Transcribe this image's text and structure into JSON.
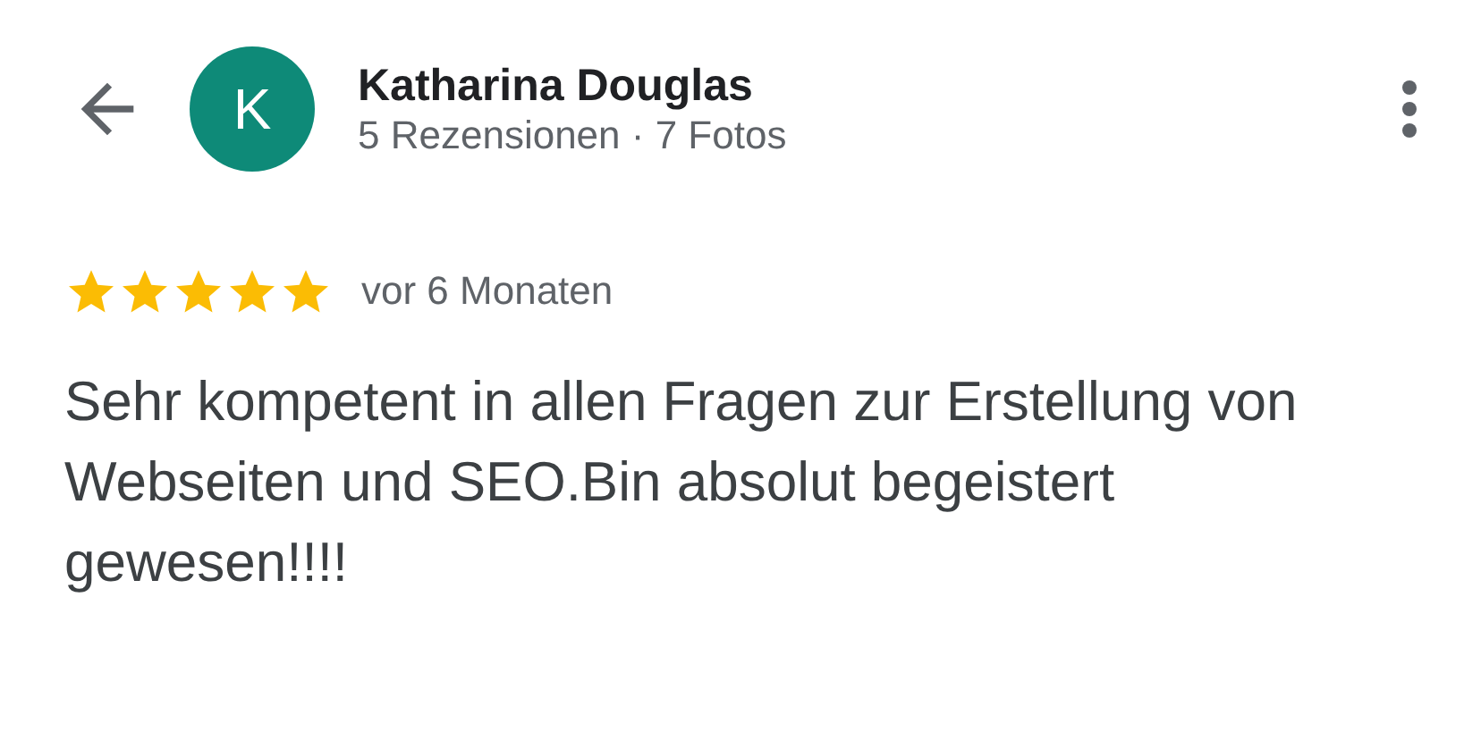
{
  "reviewer": {
    "initial": "K",
    "name": "Katharina Douglas",
    "meta": "5 Rezensionen · 7 Fotos"
  },
  "review": {
    "stars": 5,
    "time": "vor 6 Monaten",
    "text": "Sehr kompetent in allen Fragen zur Erstellung von Webseiten und SEO.Bin absolut begeistert gewesen!!!!"
  }
}
